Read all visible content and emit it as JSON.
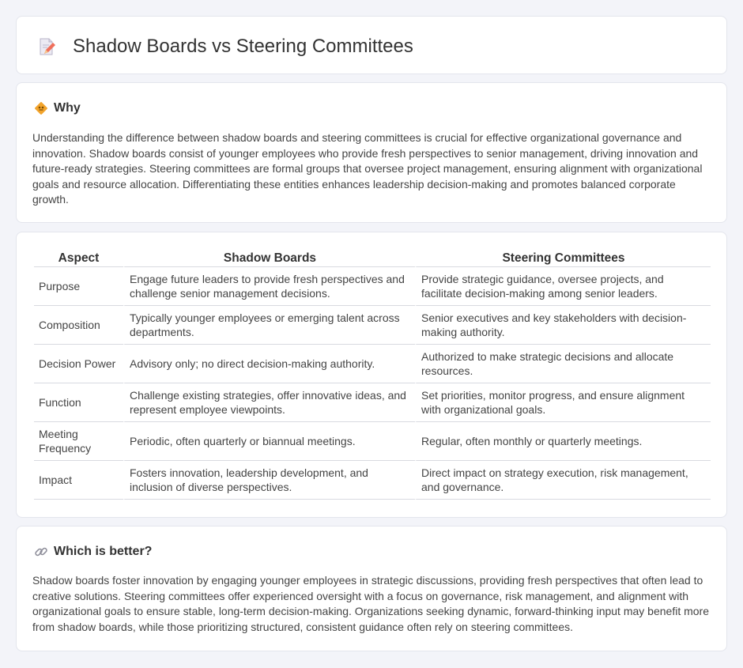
{
  "header": {
    "title": "Shadow Boards vs Steering Committees",
    "icon": "document-pencil-icon"
  },
  "why": {
    "icon": "diamond-sign-icon",
    "title": "Why",
    "body": "Understanding the difference between shadow boards and steering committees is crucial for effective organizational governance and innovation. Shadow boards consist of younger employees who provide fresh perspectives to senior management, driving innovation and future-ready strategies. Steering committees are formal groups that oversee project management, ensuring alignment with organizational goals and resource allocation. Differentiating these entities enhances leadership decision-making and promotes balanced corporate growth."
  },
  "comparison": {
    "headers": [
      "Aspect",
      "Shadow Boards",
      "Steering Committees"
    ],
    "rows": [
      {
        "aspect": "Purpose",
        "shadow": "Engage future leaders to provide fresh perspectives and challenge senior management decisions.",
        "steering": "Provide strategic guidance, oversee projects, and facilitate decision-making among senior leaders."
      },
      {
        "aspect": "Composition",
        "shadow": "Typically younger employees or emerging talent across departments.",
        "steering": "Senior executives and key stakeholders with decision-making authority."
      },
      {
        "aspect": "Decision Power",
        "shadow": "Advisory only; no direct decision-making authority.",
        "steering": "Authorized to make strategic decisions and allocate resources."
      },
      {
        "aspect": "Function",
        "shadow": "Challenge existing strategies, offer innovative ideas, and represent employee viewpoints.",
        "steering": "Set priorities, monitor progress, and ensure alignment with organizational goals."
      },
      {
        "aspect": "Meeting Frequency",
        "shadow": "Periodic, often quarterly or biannual meetings.",
        "steering": "Regular, often monthly or quarterly meetings."
      },
      {
        "aspect": "Impact",
        "shadow": "Fosters innovation, leadership development, and inclusion of diverse perspectives.",
        "steering": "Direct impact on strategy execution, risk management, and governance."
      }
    ]
  },
  "better": {
    "icon": "link-icon",
    "title": "Which is better?",
    "body": "Shadow boards foster innovation by engaging younger employees in strategic discussions, providing fresh perspectives that often lead to creative solutions. Steering committees offer experienced oversight with a focus on governance, risk management, and alignment with organizational goals to ensure stable, long-term decision-making. Organizations seeking dynamic, forward-thinking input may benefit more from shadow boards, while those prioritizing structured, consistent guidance often rely on steering committees."
  },
  "colors": {
    "page_background": "#f3f4f9",
    "card_background": "#ffffff",
    "accent_orange": "#f2a42c"
  }
}
